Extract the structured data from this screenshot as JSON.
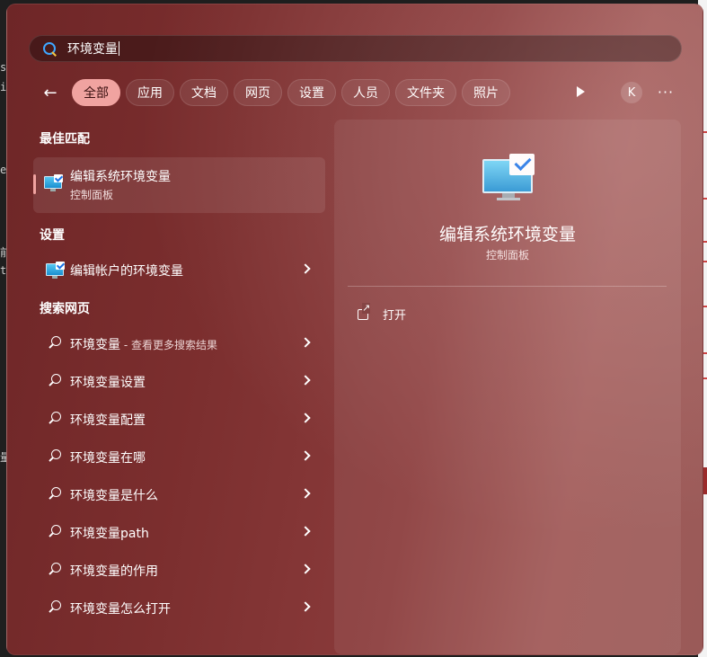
{
  "search": {
    "query": "环境变量"
  },
  "filters": {
    "back_label": "←",
    "chips": [
      "全部",
      "应用",
      "文档",
      "网页",
      "设置",
      "人员",
      "文件夹",
      "照片"
    ],
    "active": "全部",
    "avatar_letter": "K",
    "more_label": "···"
  },
  "best_match": {
    "heading": "最佳匹配",
    "name": "编辑系统环境变量",
    "subtitle": "控制面板"
  },
  "settings": {
    "heading": "设置",
    "items": [
      {
        "label": "编辑帐户的环境变量"
      }
    ]
  },
  "web": {
    "heading": "搜索网页",
    "first": {
      "query": "环境变量",
      "suffix": " - 查看更多搜索结果"
    },
    "items": [
      "环境变量设置",
      "环境变量配置",
      "环境变量在哪",
      "环境变量是什么",
      "环境变量path",
      "环境变量的作用",
      "环境变量怎么打开"
    ]
  },
  "preview": {
    "title": "编辑系统环境变量",
    "subtitle": "控制面板",
    "open_label": "打开"
  },
  "background": {
    "left_fragments": [
      "s",
      "i",
      "",
      "e",
      "",
      "前",
      "t",
      "",
      "量"
    ]
  }
}
